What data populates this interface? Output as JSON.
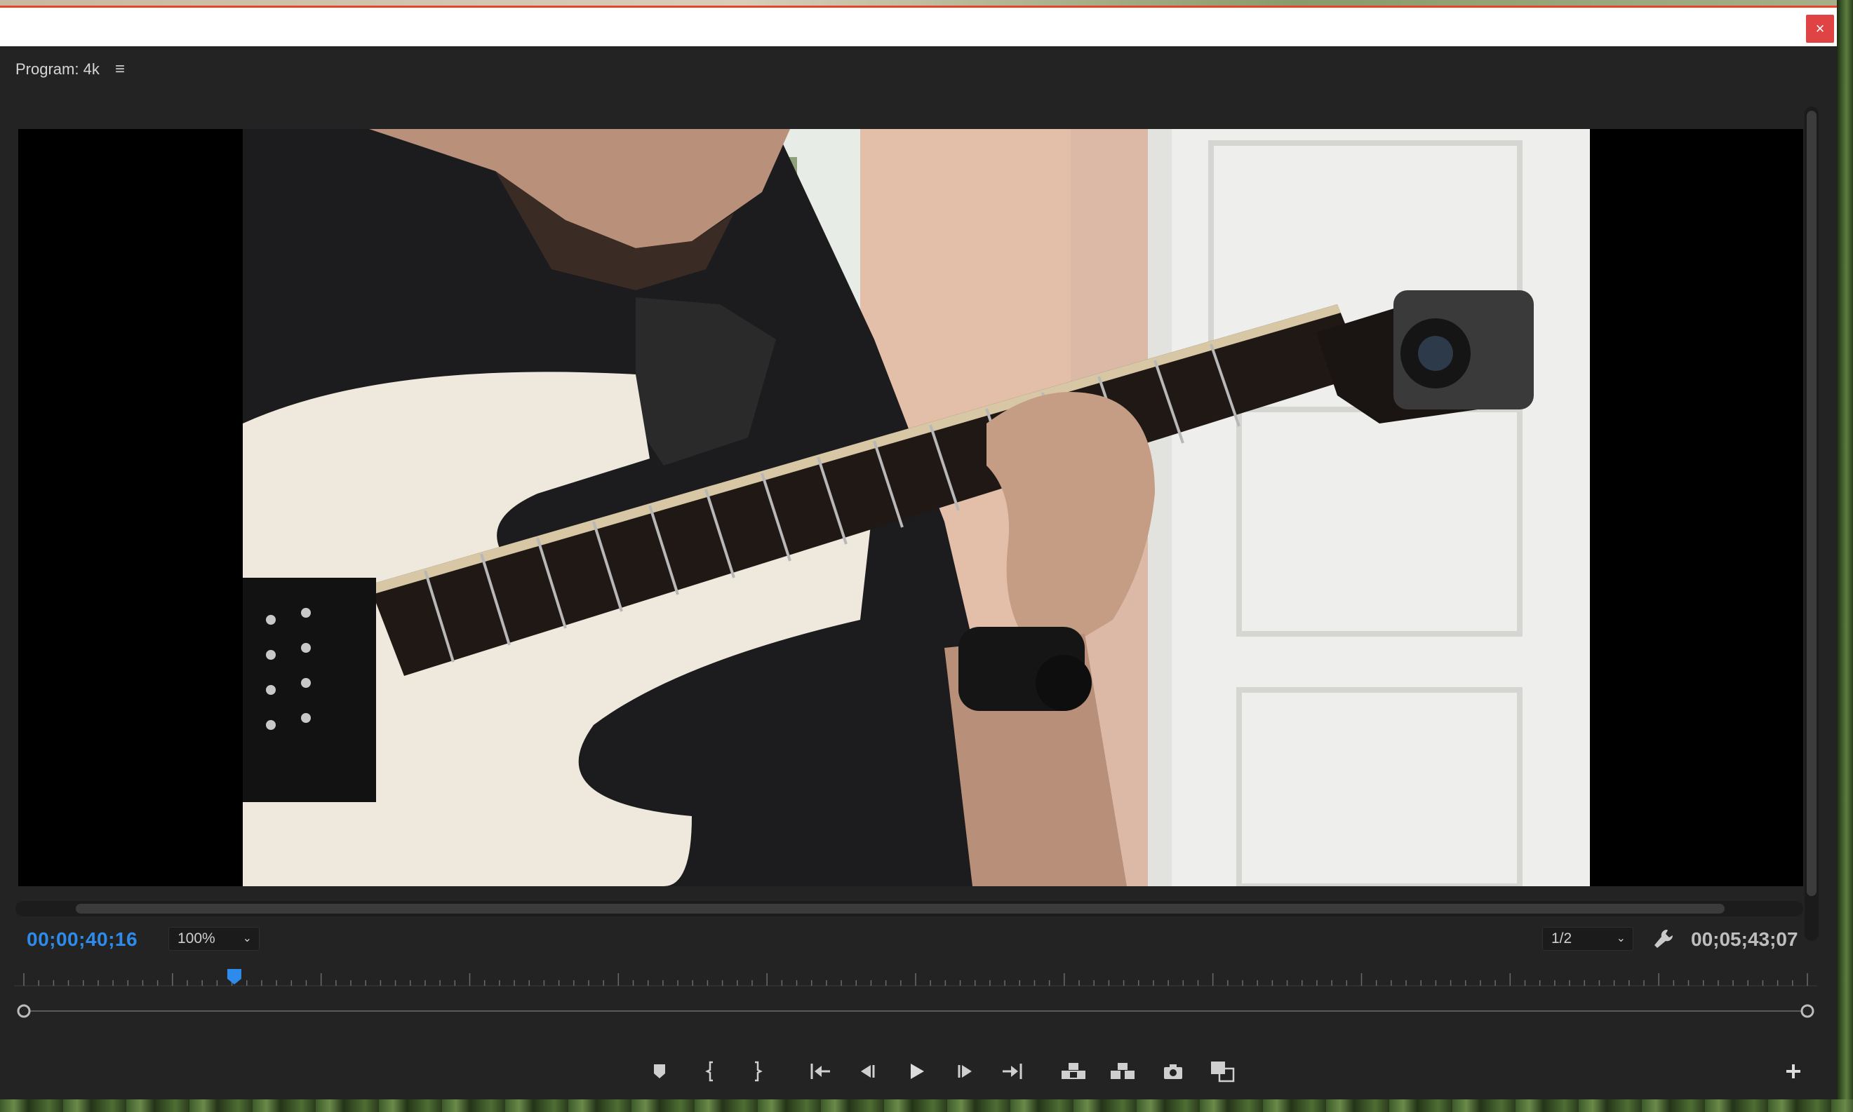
{
  "window": {
    "close_label": "×"
  },
  "panel": {
    "title": "Program: 4k",
    "menu_icon": "hamburger-menu-icon"
  },
  "viewer": {
    "current_timecode": "00;00;40;16",
    "duration_timecode": "00;05;43;07",
    "zoom": {
      "selected": "100%"
    },
    "playback_resolution": {
      "selected": "1/2"
    },
    "playhead_position_fraction": 0.118
  },
  "transport_buttons": [
    {
      "name": "add-marker-button",
      "icon": "marker-icon"
    },
    {
      "name": "mark-in-button",
      "icon": "mark-in-icon"
    },
    {
      "name": "mark-out-button",
      "icon": "mark-out-icon"
    },
    {
      "name": "go-to-in-button",
      "icon": "go-to-in-icon"
    },
    {
      "name": "step-back-button",
      "icon": "step-back-icon"
    },
    {
      "name": "play-button",
      "icon": "play-icon"
    },
    {
      "name": "step-forward-button",
      "icon": "step-forward-icon"
    },
    {
      "name": "go-to-out-button",
      "icon": "go-to-out-icon"
    },
    {
      "name": "lift-button",
      "icon": "lift-icon"
    },
    {
      "name": "extract-button",
      "icon": "extract-icon"
    },
    {
      "name": "export-frame-button",
      "icon": "camera-icon"
    },
    {
      "name": "comparison-view-button",
      "icon": "comparison-view-icon"
    }
  ],
  "colors": {
    "panel_bg": "#232323",
    "accent_timecode": "#2d8ceb",
    "close_button": "#e04343"
  }
}
